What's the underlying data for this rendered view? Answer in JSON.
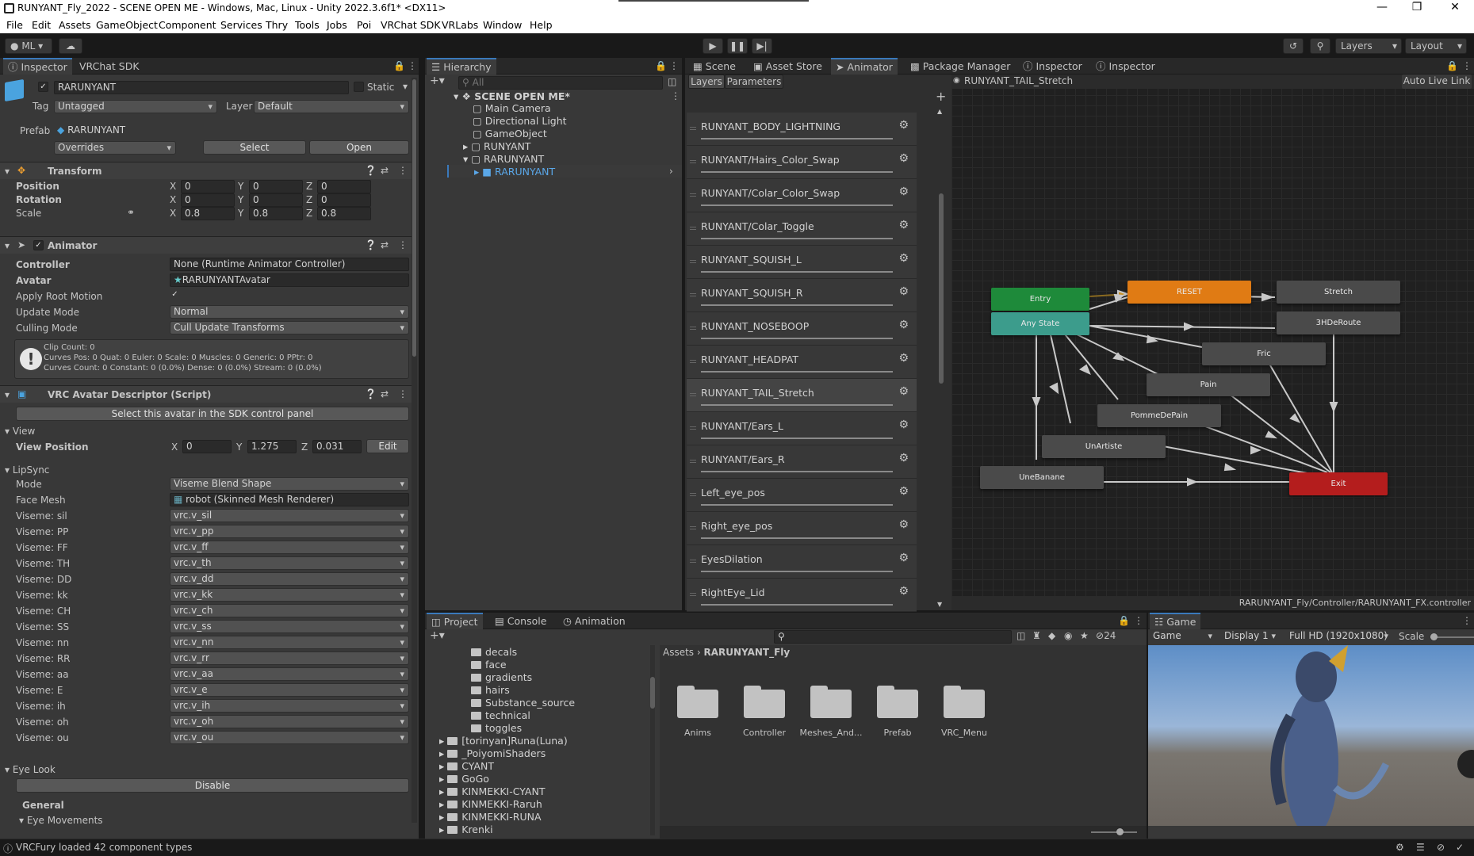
{
  "window": {
    "title": "RUNYANT_Fly_2022 - SCENE OPEN ME - Windows, Mac, Linux - Unity 2022.3.6f1* <DX11>",
    "controls": [
      "—",
      "❐",
      "✕"
    ]
  },
  "menu": [
    "File",
    "Edit",
    "Assets",
    "GameObject",
    "Component",
    "Services",
    "Thry",
    "Tools",
    "Jobs",
    "Poi",
    "VRChat SDK",
    "VRLabs",
    "Window",
    "Help"
  ],
  "toolbar": {
    "account": "ML",
    "layers": "Layers",
    "layout": "Layout"
  },
  "inspector": {
    "tabs": [
      "Inspector",
      "VRChat SDK"
    ],
    "object_name": "RARUNYANT",
    "static_label": "Static",
    "tag_label": "Tag",
    "tag_value": "Untagged",
    "layer_label": "Layer",
    "layer_value": "Default",
    "prefab_label": "Prefab",
    "prefab_value": "RARUNYANT",
    "overrides": "Overrides",
    "select": "Select",
    "open": "Open",
    "transform": {
      "title": "Transform",
      "rows": [
        {
          "label": "Position",
          "x": "0",
          "y": "0",
          "z": "0"
        },
        {
          "label": "Rotation",
          "x": "0",
          "y": "0",
          "z": "0"
        },
        {
          "label": "Scale",
          "x": "0.8",
          "y": "0.8",
          "z": "0.8"
        }
      ]
    },
    "animator": {
      "title": "Animator",
      "controller_label": "Controller",
      "controller_value": "None (Runtime Animator Controller)",
      "avatar_label": "Avatar",
      "avatar_value": "RARUNYANTAvatar",
      "root_motion_label": "Apply Root Motion",
      "update_mode_label": "Update Mode",
      "update_mode_value": "Normal",
      "culling_label": "Culling Mode",
      "culling_value": "Cull Update Transforms",
      "info1": "Clip Count: 0",
      "info2": "Curves Pos: 0 Quat: 0 Euler: 0 Scale: 0 Muscles: 0 Generic: 0 PPtr: 0",
      "info3": "Curves Count: 0 Constant: 0 (0.0%) Dense: 0 (0.0%) Stream: 0 (0.0%)"
    },
    "vrc": {
      "title": "VRC Avatar Descriptor (Script)",
      "sdk_button": "Select this avatar in the SDK control panel",
      "view_section": "View",
      "view_pos_label": "View Position",
      "vx": "0",
      "vy": "1.275",
      "vz": "0.031",
      "edit": "Edit",
      "lipsync_section": "LipSync",
      "mode_label": "Mode",
      "mode_value": "Viseme Blend Shape",
      "facemesh_label": "Face Mesh",
      "facemesh_value": "robot (Skinned Mesh Renderer)",
      "visemes": [
        {
          "label": "Viseme: sil",
          "value": "vrc.v_sil"
        },
        {
          "label": "Viseme: PP",
          "value": "vrc.v_pp"
        },
        {
          "label": "Viseme: FF",
          "value": "vrc.v_ff"
        },
        {
          "label": "Viseme: TH",
          "value": "vrc.v_th"
        },
        {
          "label": "Viseme: DD",
          "value": "vrc.v_dd"
        },
        {
          "label": "Viseme: kk",
          "value": "vrc.v_kk"
        },
        {
          "label": "Viseme: CH",
          "value": "vrc.v_ch"
        },
        {
          "label": "Viseme: SS",
          "value": "vrc.v_ss"
        },
        {
          "label": "Viseme: nn",
          "value": "vrc.v_nn"
        },
        {
          "label": "Viseme: RR",
          "value": "vrc.v_rr"
        },
        {
          "label": "Viseme: aa",
          "value": "vrc.v_aa"
        },
        {
          "label": "Viseme: E",
          "value": "vrc.v_e"
        },
        {
          "label": "Viseme: ih",
          "value": "vrc.v_ih"
        },
        {
          "label": "Viseme: oh",
          "value": "vrc.v_oh"
        },
        {
          "label": "Viseme: ou",
          "value": "vrc.v_ou"
        }
      ],
      "eyelook_section": "Eye Look",
      "disable": "Disable",
      "general": "General",
      "eye_movements": "Eye Movements"
    }
  },
  "hierarchy": {
    "tab": "Hierarchy",
    "search_placeholder": "All",
    "scene": "SCENE OPEN ME*",
    "items": [
      "Main Camera",
      "Directional Light",
      "GameObject",
      "RUNYANT",
      "RARUNYANT",
      "RARUNYANT"
    ]
  },
  "center_tabs": [
    "Scene",
    "Asset Store",
    "Animator",
    "Package Manager",
    "Inspector",
    "Inspector"
  ],
  "animator": {
    "subtabs": [
      "Layers",
      "Parameters"
    ],
    "breadcrumb": "RUNYANT_TAIL_Stretch",
    "auto_live_link": "Auto Live Link",
    "footer_path": "RARUNYANT_Fly/Controller/RARUNYANT_FX.controller",
    "layers": [
      "RUNYANT_BODY_LIGHTNING",
      "RUNYANT/Hairs_Color_Swap",
      "RUNYANT/Colar_Color_Swap",
      "RUNYANT/Colar_Toggle",
      "RUNYANT_SQUISH_L",
      "RUNYANT_SQUISH_R",
      "RUNYANT_NOSEBOOP",
      "RUNYANT_HEADPAT",
      "RUNYANT_TAIL_Stretch",
      "RUNYANT/Ears_L",
      "RUNYANT/Ears_R",
      "Left_eye_pos",
      "Right_eye_pos",
      "EyesDilation",
      "RightEye_Lid"
    ],
    "states": {
      "entry": "Entry",
      "any": "Any State",
      "reset": "RESET",
      "stretch": "Stretch",
      "hde": "3HDeRoute",
      "fric": "Fric",
      "pain": "Pain",
      "pomme": "PommeDePain",
      "artiste": "UnArtiste",
      "banane": "UneBanane",
      "exit": "Exit"
    },
    "colors": {
      "entry": "#1e8a3a",
      "any": "#3c9c8c",
      "reset": "#e07b14",
      "exit": "#b41d1d",
      "state": "#4a4a4a"
    }
  },
  "project": {
    "tabs": [
      "Project",
      "Console",
      "Animation"
    ],
    "hidden_count": "24",
    "tree": [
      "decals",
      "face",
      "gradients",
      "hairs",
      "Substance_source",
      "technical",
      "toggles",
      "[torinyan]Runa(Luna)",
      "_PoiyomiShaders",
      "CYANT",
      "GoGo",
      "KINMEKKI-CYANT",
      "KINMEKKI-Raruh",
      "KINMEKKI-RUNA",
      "Krenki"
    ],
    "breadcrumb_root": "Assets",
    "breadcrumb_leaf": "RARUNYANT_Fly",
    "folders": [
      "Anims",
      "Controller",
      "Meshes_And...",
      "Prefab",
      "VRC_Menu"
    ]
  },
  "game": {
    "tab": "Game",
    "view": "Game",
    "display": "Display 1",
    "resolution": "Full HD (1920x1080)",
    "scale": "Scale"
  },
  "status": {
    "text": "VRCFury loaded 42 component types"
  }
}
